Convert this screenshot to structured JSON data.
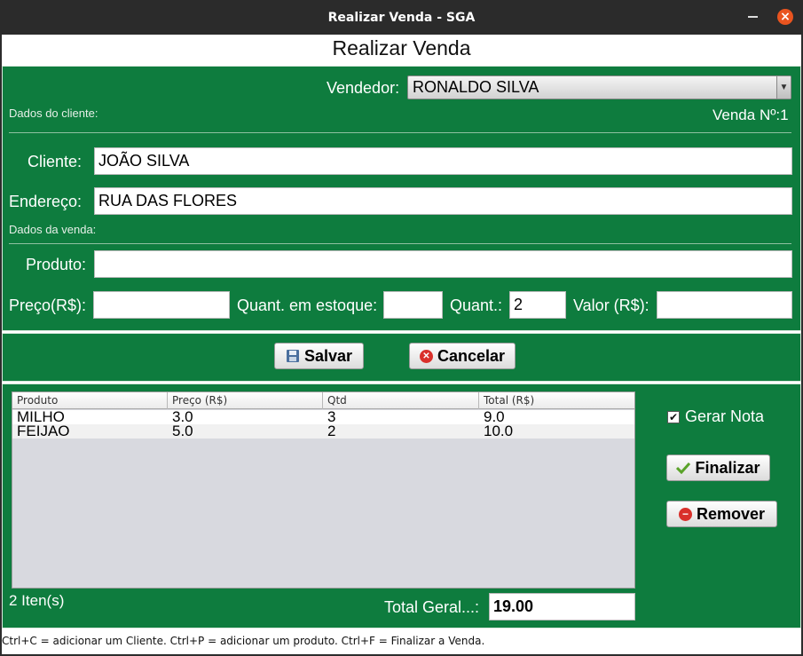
{
  "window": {
    "title": "Realizar Venda - SGA",
    "minimize": "",
    "close": "×"
  },
  "header": {
    "title": "Realizar Venda"
  },
  "top": {
    "vendedor_label": "Vendedor:",
    "vendedor_value": "RONALDO SILVA",
    "dados_cliente": "Dados do cliente:",
    "venda_numero": "Venda Nº:1"
  },
  "cliente": {
    "cliente_label": "Cliente:",
    "cliente_value": "JOÃO SILVA",
    "endereco_label": "Endereço:",
    "endereco_value": "RUA DAS FLORES"
  },
  "venda": {
    "section_label": "Dados da venda:",
    "produto_label": "Produto:",
    "produto_value": "",
    "preco_label": "Preço(R$):",
    "preco_value": "",
    "estoque_label": "Quant. em estoque:",
    "estoque_value": "",
    "quant_label": "Quant.:",
    "quant_value": "2",
    "valor_label": "Valor (R$):",
    "valor_value": ""
  },
  "actions": {
    "salvar": "Salvar",
    "cancelar": "Cancelar"
  },
  "table": {
    "columns": [
      "Produto",
      "Preço (R$)",
      "Qtd",
      "Total (R$)"
    ],
    "rows": [
      [
        "MILHO",
        "3.0",
        "3",
        "9.0"
      ],
      [
        "FEIJAO",
        "5.0",
        "2",
        "10.0"
      ]
    ]
  },
  "side": {
    "gerar_nota": "Gerar Nota",
    "gerar_nota_checked": true,
    "finalizar": "Finalizar",
    "remover": "Remover"
  },
  "summary": {
    "itens": "2 Iten(s)",
    "total_label": "Total Geral...:",
    "total_value": "19.00"
  },
  "footer": {
    "shortcuts": "Ctrl+C = adicionar um Cliente. Ctrl+P = adicionar um produto. Ctrl+F = Finalizar a Venda."
  },
  "colors": {
    "panel": "#0e7c3e",
    "cancel_icon": "#d9302b",
    "check_icon": "#5aa329"
  }
}
